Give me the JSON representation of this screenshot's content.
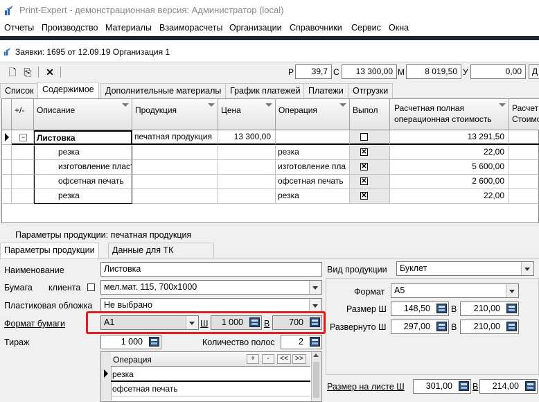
{
  "window": {
    "title": "Print-Expert - демонстрационная версия: Администратор (local)"
  },
  "menu": [
    "Отчеты",
    "Производство",
    "Материалы",
    "Взаиморасчеты",
    "Организации",
    "Справочники",
    "Сервис",
    "Окна"
  ],
  "document": {
    "title": "Заявки: 1695 от 12.09.19  Организация 1"
  },
  "toolbar": {
    "fields": [
      {
        "label": "Р",
        "value": "39,7"
      },
      {
        "label": "С",
        "value": "13 300,00"
      },
      {
        "label": "М",
        "value": "8 019,50"
      },
      {
        "label": "У",
        "value": "0,00"
      }
    ],
    "extra_button": "Д"
  },
  "tabs": [
    "Список",
    "Содержимое",
    "Дополнительные материалы",
    "График платежей",
    "Платежи",
    "Отгрузки"
  ],
  "grid": {
    "columns": [
      "+/-",
      "Описание",
      "Продукция",
      "Цена",
      "Операция",
      "Выпол",
      "Расчетная полная операционная стоимость",
      "Расчет Стоимо"
    ],
    "rows": [
      {
        "toggle": "−",
        "description": "Листовка",
        "product": "печатная продукция",
        "price": "13 300,00",
        "operation": "",
        "done": false,
        "cost": "13 291,50"
      },
      {
        "toggle": "",
        "description": "резка",
        "product": "",
        "price": "",
        "operation": "резка",
        "done": true,
        "cost": "22,00"
      },
      {
        "toggle": "",
        "description": "изготовление пласт",
        "product": "",
        "price": "",
        "operation": "изготовление пла",
        "done": true,
        "cost": "5 600,00"
      },
      {
        "toggle": "",
        "description": "офсетная печать",
        "product": "",
        "price": "",
        "operation": "офсетная печать",
        "done": true,
        "cost": "2 600,00"
      },
      {
        "toggle": "",
        "description": "резка",
        "product": "",
        "price": "",
        "operation": "резка",
        "done": true,
        "cost": "22,00"
      }
    ]
  },
  "params": {
    "header": "Параметры продукции: печатная продукция",
    "tabs": [
      "Параметры продукции",
      "Данные для ТК"
    ],
    "name_label": "Наименование",
    "name_value": "Листовка",
    "paper_label": "Бумага",
    "client_label": "клиента",
    "paper_value": "мел.мат. 115, 700x1000",
    "cover_label": "Пластиковая обложка",
    "cover_value": "Не выбрано",
    "paper_format_label": "Формат бумаги",
    "paper_format_value": "A1",
    "w_label": "Ш",
    "w_value": "1 000",
    "h_label": "В",
    "h_value": "700",
    "tirazh_label": "Тираж",
    "tirazh_value": "1 000",
    "strips_label": "Количество полос",
    "strips_value": "2",
    "kind_label": "Вид продукции",
    "kind_value": "Буклет",
    "format_label": "Формат",
    "format_value": "A5",
    "size_label": "Размер Ш",
    "size_w": "148,50",
    "size_h": "210,00",
    "unfolded_label": "Развернуто Ш",
    "unfolded_w": "297,00",
    "unfolded_h": "210,00",
    "sheet_label": "Размер на листе Ш",
    "sheet_w": "301,00",
    "sheet_h": "214,00",
    "b_label": "В",
    "ops": {
      "header": "Операция",
      "buttons": [
        "+",
        "-",
        "<<",
        ">>"
      ],
      "rows": [
        "резка",
        "офсетная печать"
      ]
    }
  }
}
